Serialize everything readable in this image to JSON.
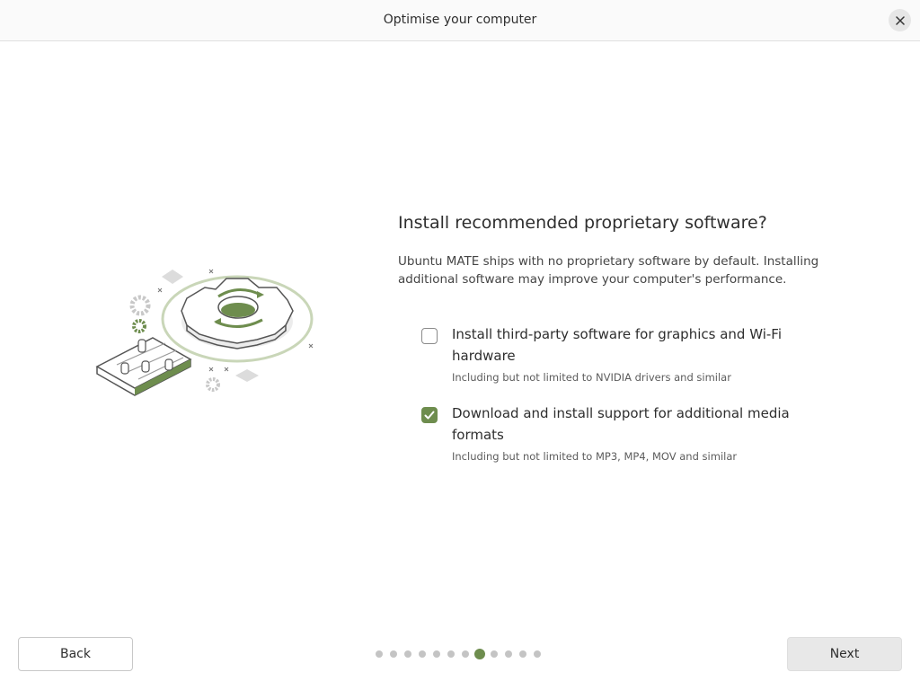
{
  "window": {
    "title": "Optimise your computer",
    "close_icon": "close-icon"
  },
  "main": {
    "heading": "Install recommended proprietary software?",
    "description": "Ubuntu MATE ships with no proprietary software by default. Installing additional software may improve your computer's performance.",
    "options": [
      {
        "label": "Install third-party software for graphics and Wi-Fi hardware",
        "sublabel": "Including but not limited to NVIDIA drivers and similar",
        "checked": false
      },
      {
        "label": "Download and install support for additional media formats",
        "sublabel": "Including but not limited to MP3, MP4, MOV and similar",
        "checked": true
      }
    ]
  },
  "footer": {
    "back_label": "Back",
    "next_label": "Next",
    "pager": {
      "total": 12,
      "current": 8
    }
  },
  "colors": {
    "accent": "#6e8d4e",
    "dot_inactive": "#c4c4c4"
  }
}
